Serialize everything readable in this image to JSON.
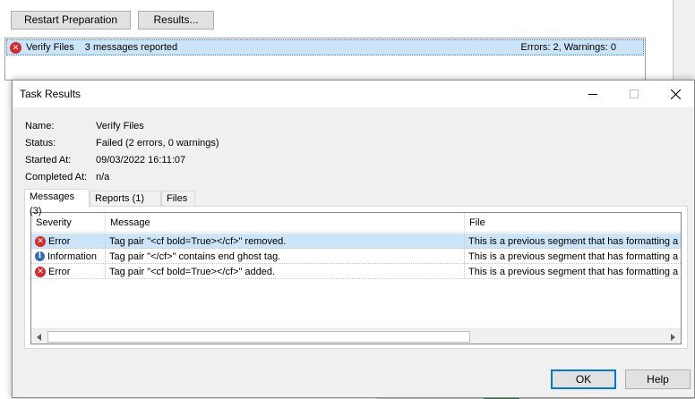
{
  "toolbar": {
    "restart_label": "Restart Preparation",
    "results_label": "Results..."
  },
  "task_list": {
    "name": "Verify Files",
    "messages": "3 messages reported",
    "summary": "Errors: 2, Warnings: 0"
  },
  "dialog": {
    "title": "Task Results",
    "info": {
      "name_label": "Name:",
      "name_value": "Verify Files",
      "status_label": "Status:",
      "status_value": "Failed (2 errors, 0 warnings)",
      "started_label": "Started At:",
      "started_value": "09/03/2022 16:11:07",
      "completed_label": "Completed At:",
      "completed_value": "n/a"
    },
    "tabs": [
      "Messages (3)",
      "Reports (1)",
      "Files"
    ],
    "columns": [
      "Severity",
      "Message",
      "File"
    ],
    "rows": [
      {
        "icon": "error-icon",
        "severity": "Error",
        "message": "Tag pair \"<cf bold=True></cf>\" removed.",
        "file": "This is a previous segment that has formatting a"
      },
      {
        "icon": "info-icon",
        "severity": "Information",
        "message": "Tag pair \"</cf>\" contains end ghost tag.",
        "file": "This is a previous segment that has formatting a"
      },
      {
        "icon": "error-icon",
        "severity": "Error",
        "message": "Tag pair \"<cf bold=True></cf>\" added.",
        "file": "This is a previous segment that has formatting a"
      }
    ],
    "ok_label": "OK",
    "help_label": "Help"
  },
  "colors": {
    "selection": "#cce4f7",
    "error": "#d42a2a",
    "info": "#2f6db5",
    "accent": "#0078d7"
  }
}
